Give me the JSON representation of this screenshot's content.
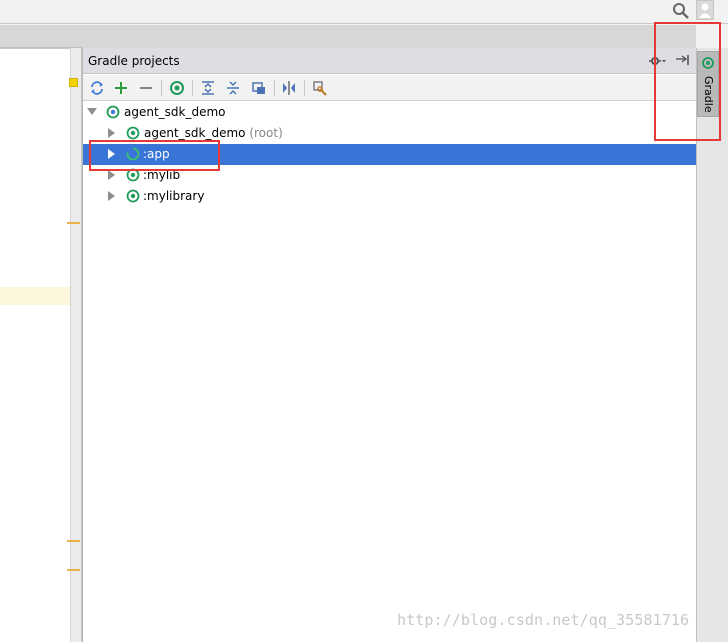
{
  "gradle_panel": {
    "title": "Gradle projects"
  },
  "right_strip": {
    "gradle_tab_label": "Gradle"
  },
  "tree": {
    "root": {
      "label": "agent_sdk_demo"
    },
    "items": [
      {
        "label": "agent_sdk_demo",
        "suffix": " (root)"
      },
      {
        "label": ":app",
        "suffix": ""
      },
      {
        "label": ":mylib",
        "suffix": ""
      },
      {
        "label": ":mylibrary",
        "suffix": ""
      }
    ]
  },
  "watermark": "http://blog.csdn.net/qq_35581716",
  "colors": {
    "selection": "#3875d7",
    "annotation": "#e53935",
    "gradle_green": "#1e9c5a"
  },
  "icons": {
    "toolbar": [
      "refresh-icon",
      "add-icon",
      "remove-icon",
      "execute-task-icon",
      "expand-all-icon",
      "collapse-all-icon",
      "attach-project-icon",
      "toggle-offline-icon",
      "settings-wrench-icon"
    ]
  }
}
